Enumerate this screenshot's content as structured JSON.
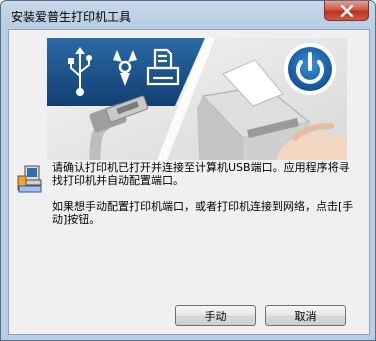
{
  "window": {
    "title": "安装爱普生打印机工具",
    "close_icon": "close-icon"
  },
  "banner": {
    "icons": [
      "usb-icon",
      "firewire-icon",
      "network-printer-icon",
      "power-icon"
    ],
    "colors": {
      "panel": "#1a4f8a",
      "power_button": "#1a66b0"
    }
  },
  "message": {
    "line1": "请确认打印机已打开并连接至计算机USB端口。应用程序将寻找打印机并自动配置端口。",
    "line2": "如果想手动配置打印机端口，或者打印机连接到网络，点击[手动]按钮。"
  },
  "buttons": {
    "manual": "手动",
    "cancel": "取消"
  }
}
